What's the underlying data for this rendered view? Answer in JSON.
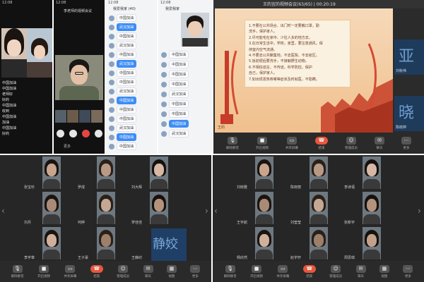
{
  "panel1": {
    "phone1": {
      "status": "12:08",
      "chat": [
        "中国加油",
        "中国加油",
        "老师好",
        "好的",
        "中国加油",
        "收到",
        "中国加油",
        "加油",
        "中国加油",
        "好的"
      ]
    },
    "phone2": {
      "status": "12:08",
      "header": "李老师的视频会议",
      "toolbar_label": "更多"
    },
    "phone3": {
      "status": "12:08",
      "header": "我爱我家 (40)",
      "messages": [
        "中国加油",
        "武汉加油",
        "中国加油",
        "武汉加油",
        "中国加油",
        "武汉加油",
        "中国加油",
        "中国加油",
        "武汉加油",
        "中国加油",
        "中国加油",
        "中国加油",
        "武汉加油",
        "中国加油",
        "中国加油"
      ]
    },
    "phone4": {
      "status": "12:08",
      "header": "我爱我家",
      "messages": [
        "中国加油",
        "中国加油",
        "中国加油",
        "中国加油",
        "武汉加油",
        "中国加油",
        "中国加油",
        "中国加油",
        "武汉加油"
      ]
    }
  },
  "panel2": {
    "title": "王的宜的视频会议(63/65) | 00:20:19",
    "presenter": "王的",
    "notice_lines": [
      "1.不要在公共场合、出门时一定要戴口罩，勤",
      "  洗手，保护家人。",
      "2.尽可能宅在家中、少往人多的地方去。",
      "3.在日常生活中，学校，家里，要注意通风，保",
      "  持室内空气流通。",
      "4.不要去公共聚集地，不去医院、不去疫区。",
      "5.饭前便后要洗手，不接触野生动物。",
      "6.不相信谣言，不传谣，科学防控，保护",
      "  自己，保护家人。",
      "7.如出现发热咳嗽等症状及时就医，不隐瞒。"
    ],
    "side_tiles": [
      {
        "char": "亚",
        "name": "刘秋伟"
      },
      {
        "char": "晓",
        "name": "陈晓婷"
      }
    ],
    "toolbar": [
      "解除静音",
      "开启视频",
      "共享屏幕",
      "结束",
      "管理成员",
      "聊天",
      "更多"
    ]
  },
  "panel3": {
    "names_row1": [
      "张宝珍",
      "罗成",
      "刘大辉"
    ],
    "names_row2": [
      "刘月",
      "何婷",
      "罗佳佳"
    ],
    "names_row3": [
      "李宇章",
      "王子豪",
      "王静欣"
    ],
    "jing_text": "静姣",
    "toolbar": [
      "解除静音",
      "开启视频",
      "共享屏幕",
      "结束",
      "管理成员",
      "聊天",
      "视图",
      "更多"
    ]
  },
  "panel4": {
    "names_row1": [
      "刘晓雅",
      "陈晓丽",
      "李诗语"
    ],
    "names_row2": [
      "王宇航",
      "刘莹莹",
      "张新宇"
    ],
    "names_row3": [
      "杨欣然",
      "赵宇轩",
      "周思琪"
    ],
    "toolbar": [
      "解除静音",
      "开启视频",
      "共享屏幕",
      "结束",
      "管理成员",
      "聊天",
      "视图",
      "更多"
    ]
  },
  "colors": {
    "end_button": "#e8563c",
    "slide_bg": "#f0c08d",
    "blue_tile": "#1f3f66"
  }
}
